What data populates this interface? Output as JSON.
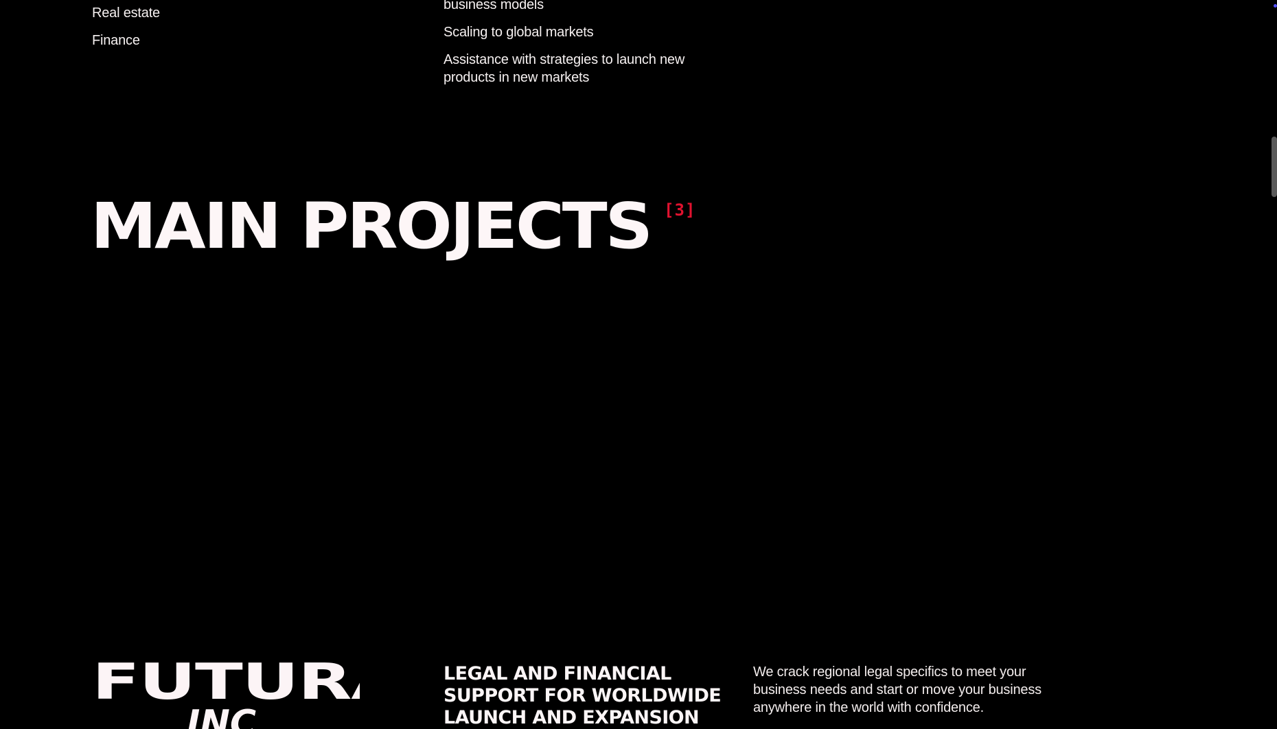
{
  "industries": {
    "items": [
      {
        "label": "Real estate"
      },
      {
        "label": "Finance"
      }
    ]
  },
  "services": {
    "items": [
      {
        "label": "business models"
      },
      {
        "label": "Scaling to global markets"
      },
      {
        "label": "Assistance with strategies to launch new products in new markets"
      }
    ]
  },
  "main_projects": {
    "title": "MAIN PROJECTS",
    "count": "[3]",
    "accent_color": "#e0122f"
  },
  "project": {
    "logo_main": "FUTURA",
    "logo_sub": "INC",
    "heading": "LEGAL AND FINANCIAL SUPPORT FOR WORLDWIDE LAUNCH AND EXPANSION",
    "description": "We crack regional legal specifics to meet your business needs and start or move your business anywhere in the world with confidence."
  },
  "colors": {
    "background": "#000000",
    "text": "#f4eeee",
    "accent": "#e0122f",
    "scrollbar": "#5a5a5a"
  }
}
